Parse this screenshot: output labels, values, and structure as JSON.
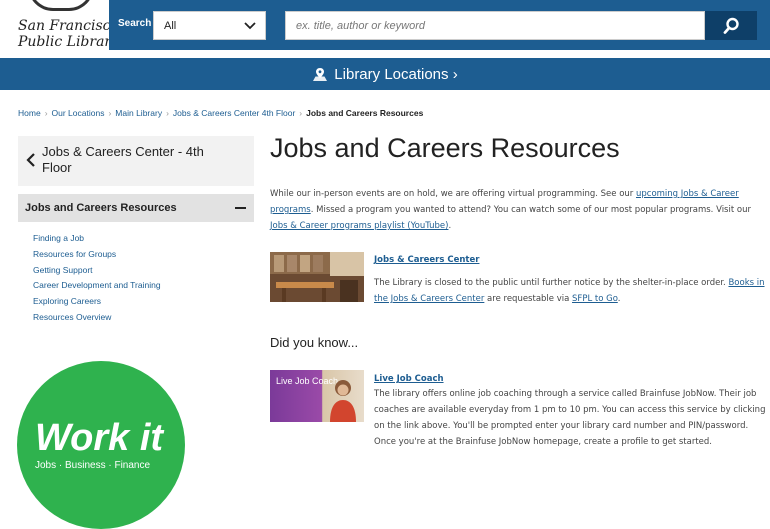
{
  "logo": {
    "line1": "San Francisco",
    "line2": "Public Library"
  },
  "search": {
    "label": "Search",
    "scope": "All",
    "placeholder": "ex. title, author or keyword"
  },
  "location_bar": {
    "label": "Library Locations ›",
    "icon": "map-marker-icon"
  },
  "breadcrumb": {
    "items": [
      "Home",
      "Our Locations",
      "Main Library",
      "Jobs & Careers Center 4th Floor"
    ],
    "current": "Jobs and Careers Resources"
  },
  "sidebar": {
    "header": "Jobs & Careers Center - 4th Floor",
    "section": "Jobs and Careers Resources",
    "links": [
      "Finding a Job",
      "Resources for Groups",
      "Getting Support",
      "Career Development and Training",
      "Exploring Careers",
      "Resources Overview"
    ]
  },
  "workit": {
    "title": "Work it",
    "subtitle": "Jobs · Business · Finance"
  },
  "main": {
    "title": "Jobs and Careers Resources",
    "intro": {
      "t1": "While our in-person events are on hold, we are offering virtual programming.  See our ",
      "l1": "upcoming Jobs & Career programs",
      "t2": ".  Missed a program you wanted to attend?  You can watch some of our most popular programs.  Visit our ",
      "l2": "Jobs & Career programs playlist (YouTube)",
      "t3": "."
    },
    "card1": {
      "title": "Jobs & Careers Center",
      "t1": "The Library is closed to the public until further notice by the shelter-in-place order. ",
      "l1": "Books in the Jobs & Careers Center",
      "t2": " are requestable via ",
      "l2": "SFPL to Go",
      "t3": "."
    },
    "did_you_know": "Did you know...",
    "card2": {
      "image_text": "Live Job Coach",
      "title": "Live Job Coach",
      "text": "The library offers online job coaching through a service called Brainfuse JobNow. Their job coaches are available everyday from 1 pm to 10 pm. You can access this service by clicking on the link above. You'll be prompted enter your library card number and PIN/password. Once you're at the Brainfuse JobNow homepage, create a profile to get started."
    }
  },
  "colors": {
    "brand_blue": "#1d5d91",
    "dark_blue": "#0e3f68",
    "green": "#2fb24e"
  }
}
